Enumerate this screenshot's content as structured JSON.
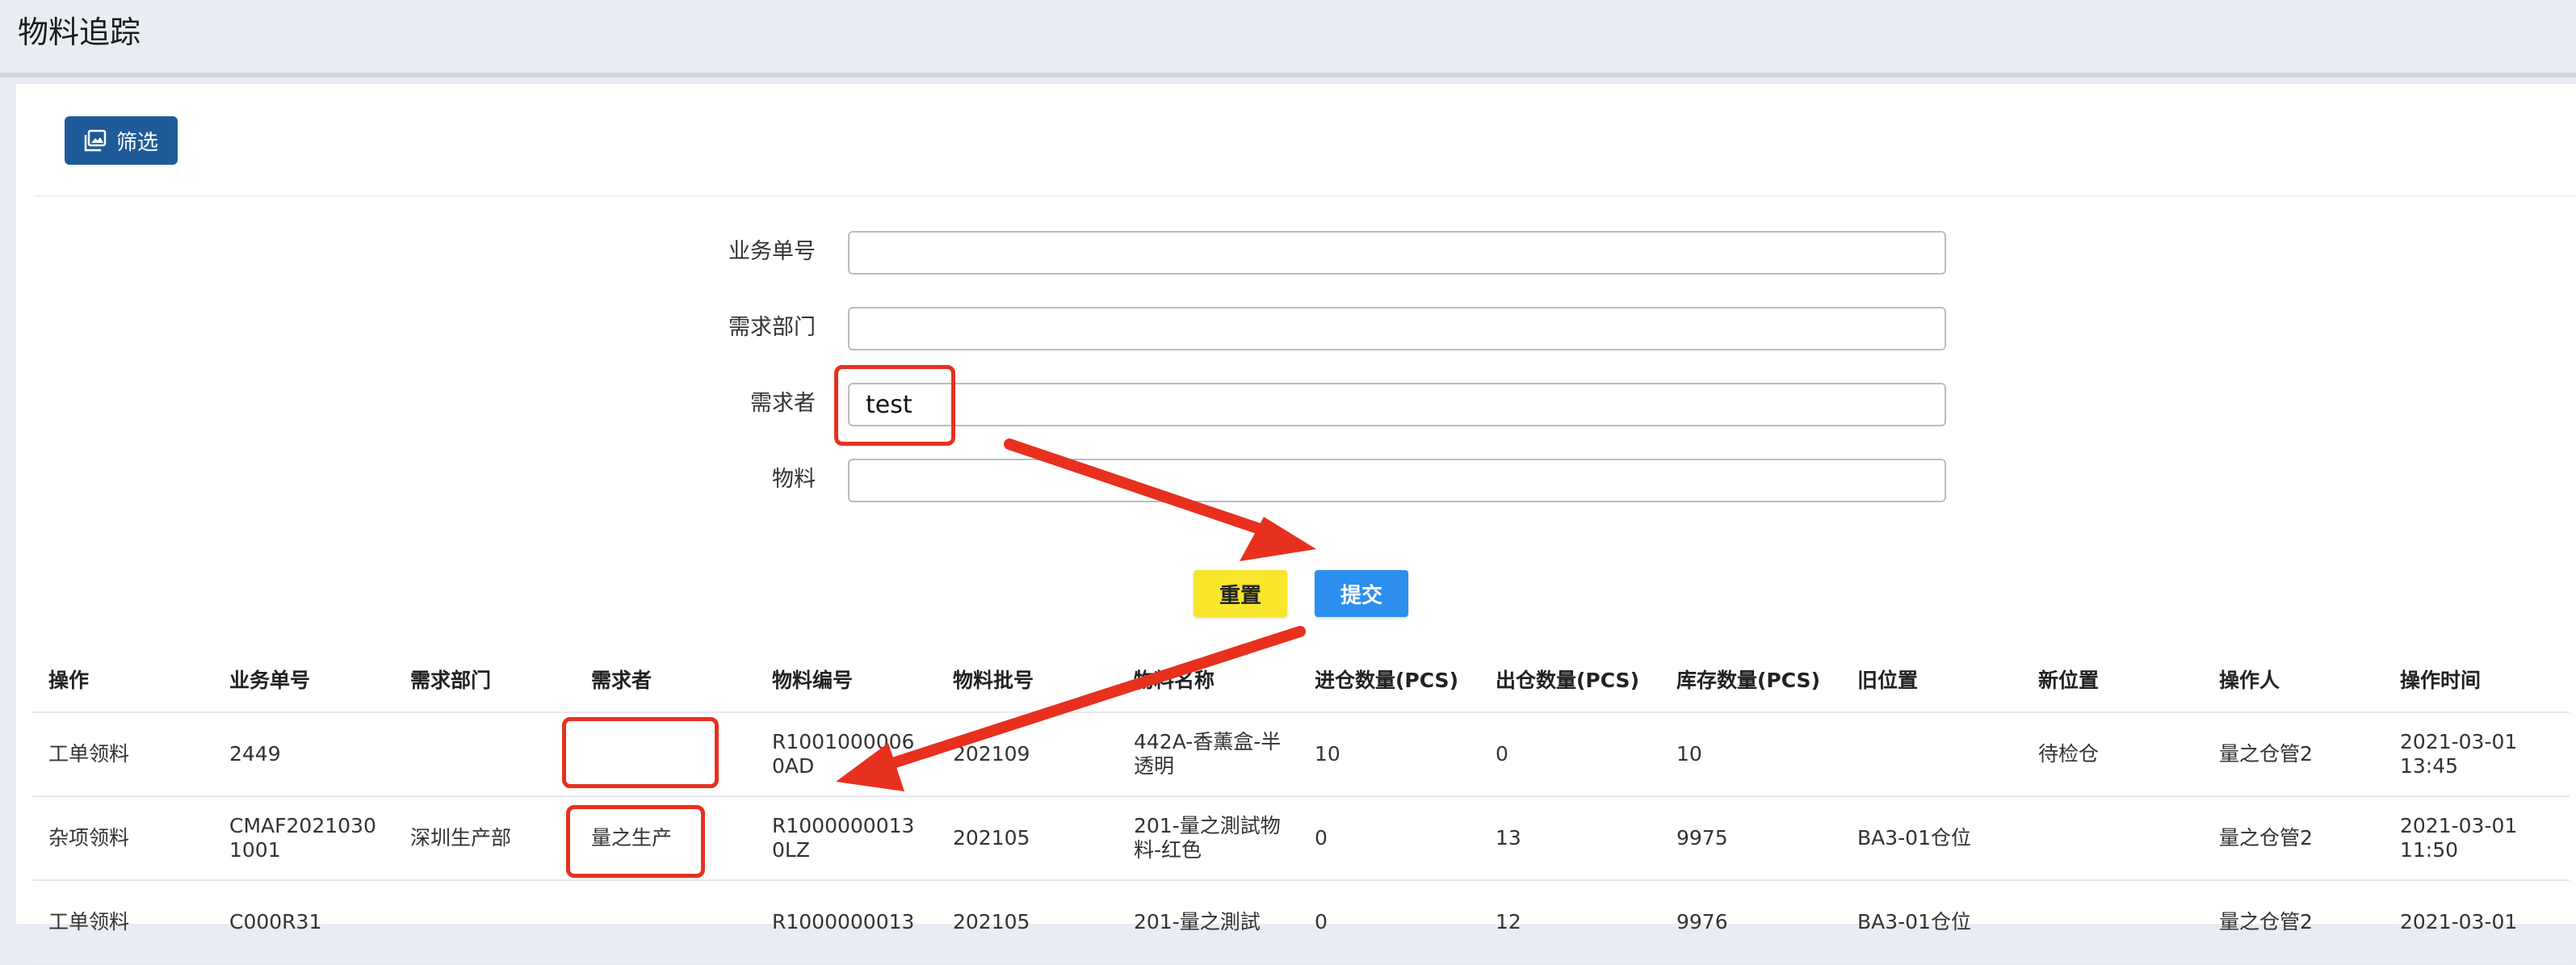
{
  "header": {
    "title": "物料追踪"
  },
  "toolbar": {
    "filter_label": "筛选"
  },
  "form": {
    "fields": [
      {
        "label": "业务单号",
        "value": ""
      },
      {
        "label": "需求部门",
        "value": ""
      },
      {
        "label": "需求者",
        "value": "test"
      },
      {
        "label": "物料",
        "value": ""
      }
    ],
    "reset_label": "重置",
    "submit_label": "提交"
  },
  "table": {
    "columns": [
      "操作",
      "业务单号",
      "需求部门",
      "需求者",
      "物料编号",
      "物料批号",
      "物料名称",
      "进仓数量(PCS)",
      "出仓数量(PCS)",
      "库存数量(PCS)",
      "旧位置",
      "新位置",
      "操作人",
      "操作时间"
    ],
    "rows": [
      [
        "工单领料",
        "2449",
        "",
        "",
        "R1001000006 0AD",
        "202109",
        "442A-香薰盒-半透明",
        "10",
        "0",
        "10",
        "",
        "待检仓",
        "量之仓管2",
        "2021-03-01 13:45"
      ],
      [
        "杂项领料",
        "CMAF2021030 1001",
        "深圳生产部",
        "量之生产",
        "R1000000013 0LZ",
        "202105",
        "201-量之測試物料-红色",
        "0",
        "13",
        "9975",
        "BA3-01仓位",
        "",
        "量之仓管2",
        "2021-03-01 11:50"
      ],
      [
        "工单领料",
        "C000R31",
        "",
        "",
        "R1000000013",
        "202105",
        "201-量之測試",
        "0",
        "12",
        "9976",
        "BA3-01仓位",
        "",
        "量之仓管2",
        "2021-03-01"
      ]
    ]
  },
  "colors": {
    "filter_button": "#1f5b99",
    "reset_button": "#f8e62c",
    "submit_button": "#2c8fee",
    "annotation": "#e8301e"
  }
}
